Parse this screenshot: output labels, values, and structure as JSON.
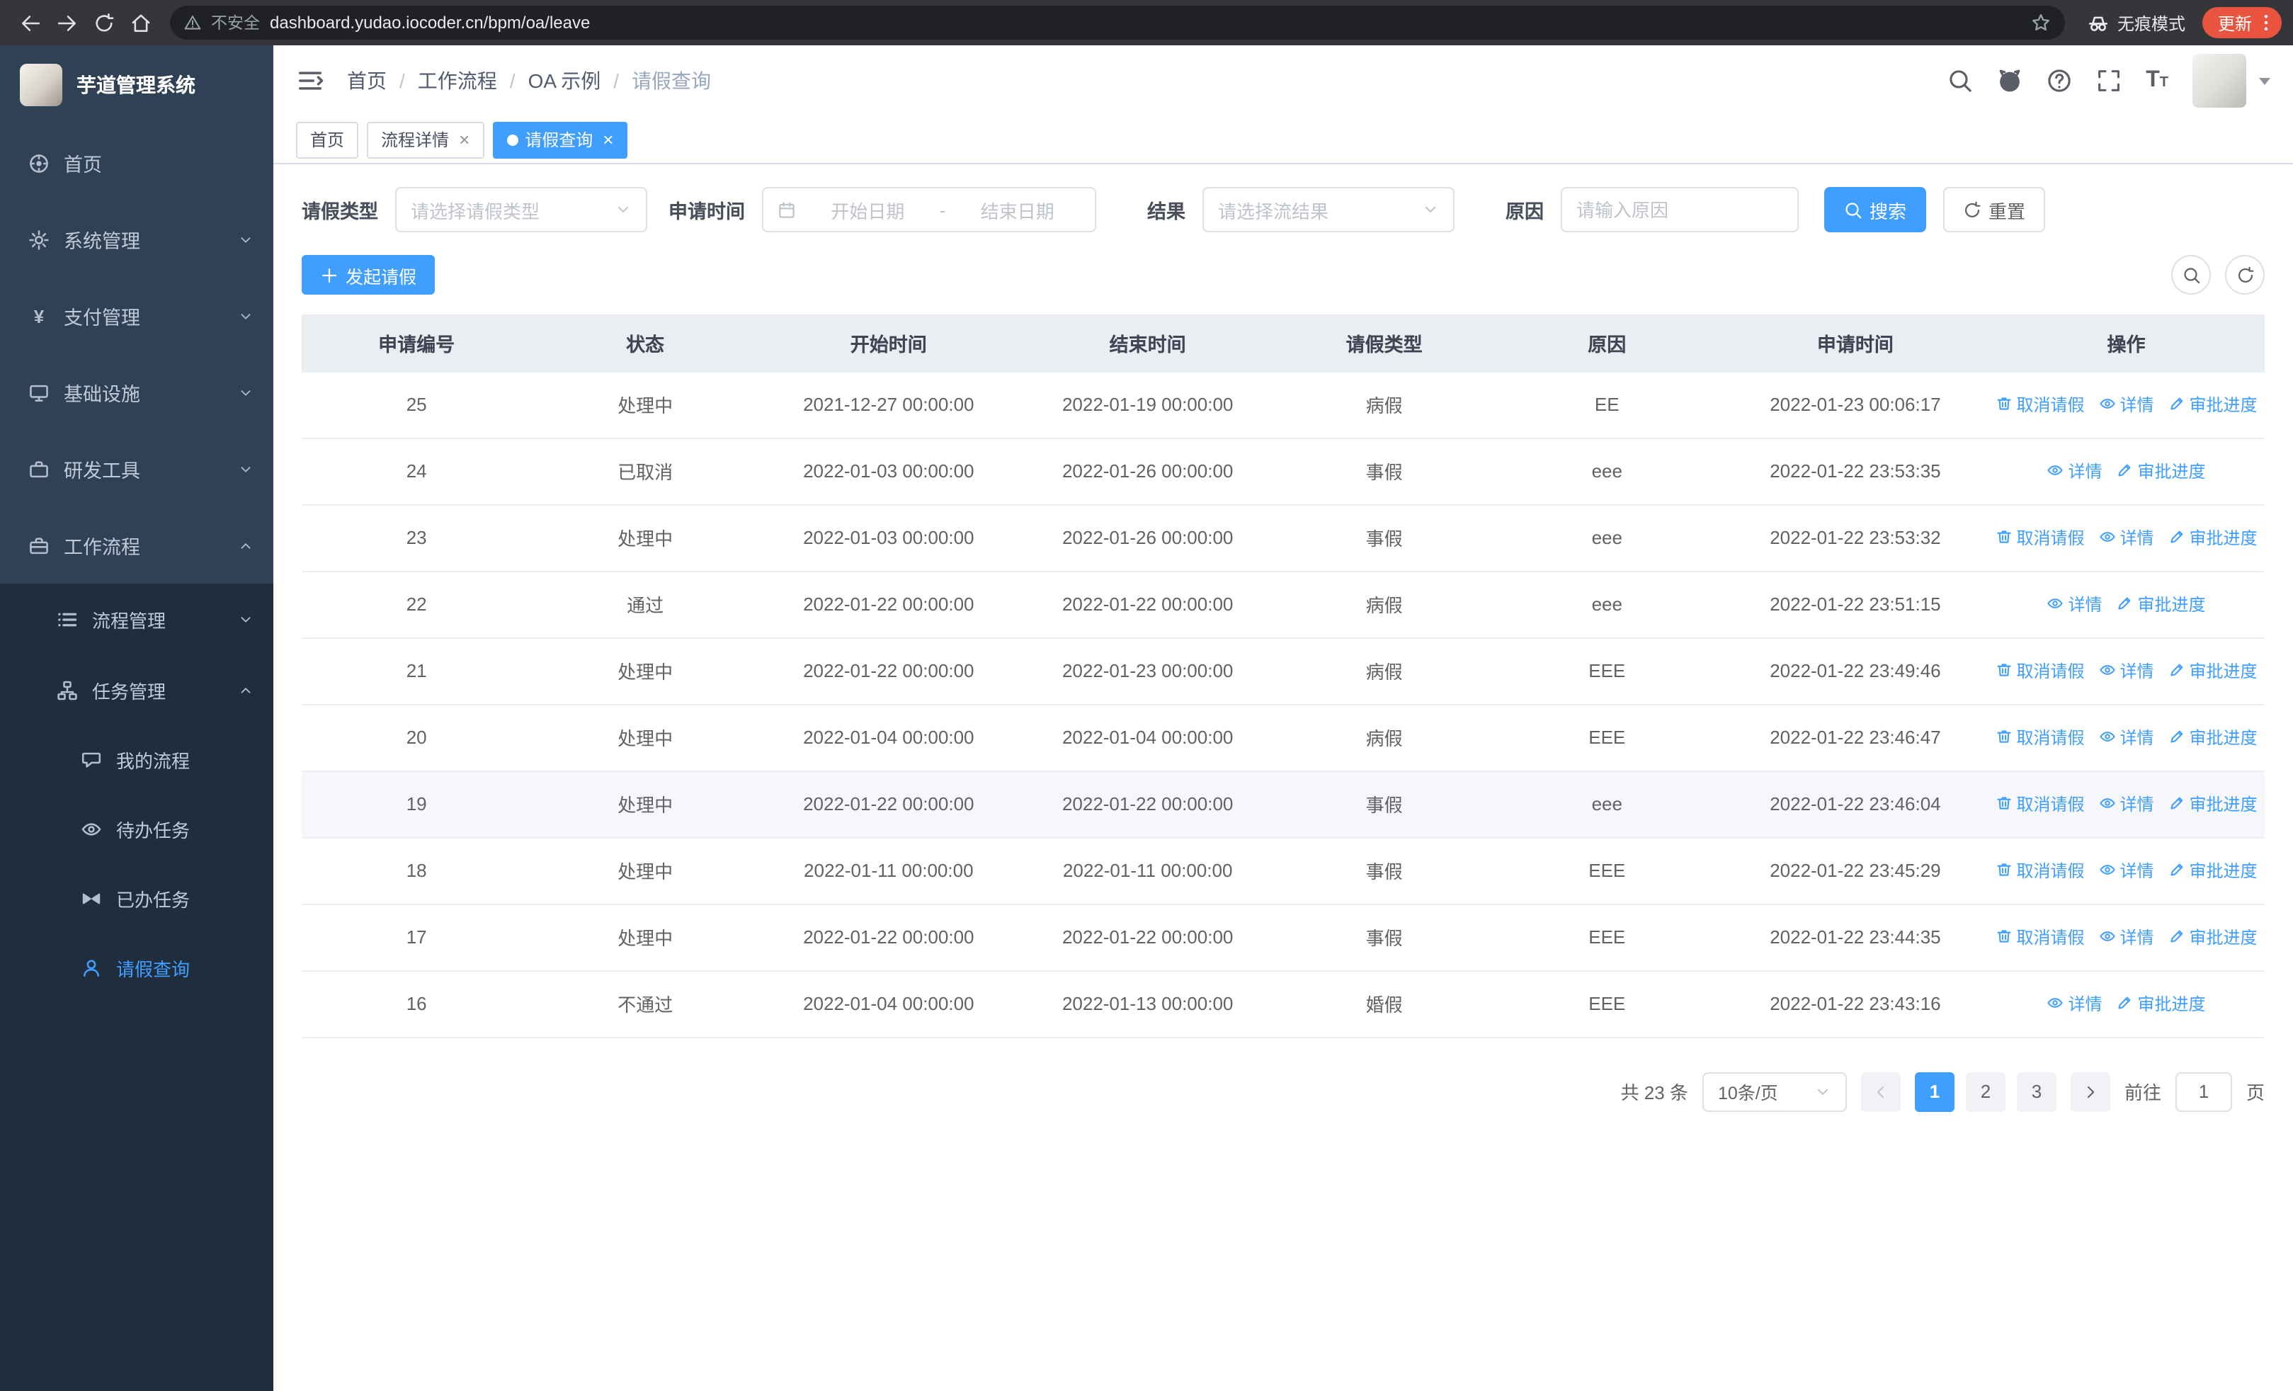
{
  "browser": {
    "security_label": "不安全",
    "url": "dashboard.yudao.iocoder.cn/bpm/oa/leave",
    "incognito_label": "无痕模式",
    "update_label": "更新"
  },
  "sidebar": {
    "logo_title": "芋道管理系统",
    "menu": [
      {
        "key": "home",
        "label": "首页",
        "icon": "home"
      },
      {
        "key": "system",
        "label": "系统管理",
        "icon": "gear",
        "state": "collapsed"
      },
      {
        "key": "payment",
        "label": "支付管理",
        "icon": "yen",
        "state": "collapsed"
      },
      {
        "key": "infra",
        "label": "基础设施",
        "icon": "monitor",
        "state": "collapsed"
      },
      {
        "key": "devtools",
        "label": "研发工具",
        "icon": "toolbox",
        "state": "collapsed"
      },
      {
        "key": "workflow",
        "label": "工作流程",
        "icon": "briefcase",
        "state": "expanded",
        "children": [
          {
            "key": "process-mgmt",
            "label": "流程管理",
            "icon": "listicon",
            "state": "collapsed"
          },
          {
            "key": "task-mgmt",
            "label": "任务管理",
            "icon": "flow",
            "state": "expanded",
            "children": [
              {
                "key": "my-process",
                "label": "我的流程",
                "icon": "chat"
              },
              {
                "key": "todo-task",
                "label": "待办任务",
                "icon": "eye"
              },
              {
                "key": "done-task",
                "label": "已办任务",
                "icon": "bowtie"
              },
              {
                "key": "leave-query",
                "label": "请假查询",
                "icon": "user",
                "active": true
              }
            ]
          }
        ]
      }
    ]
  },
  "header": {
    "breadcrumb": [
      "首页",
      "工作流程",
      "OA 示例",
      "请假查询"
    ]
  },
  "tabs": [
    {
      "key": "home",
      "label": "首页",
      "closable": false,
      "active": false
    },
    {
      "key": "process-detail",
      "label": "流程详情",
      "closable": true,
      "active": false
    },
    {
      "key": "leave-query",
      "label": "请假查询",
      "closable": true,
      "active": true
    }
  ],
  "filters": {
    "type_label": "请假类型",
    "type_placeholder": "请选择请假类型",
    "time_label": "申请时间",
    "start_placeholder": "开始日期",
    "range_separator": "-",
    "end_placeholder": "结束日期",
    "result_label": "结果",
    "result_placeholder": "请选择流结果",
    "reason_label": "原因",
    "reason_placeholder": "请输入原因",
    "search_label": "搜索",
    "reset_label": "重置"
  },
  "toolbar": {
    "create_label": "发起请假"
  },
  "table": {
    "headers": [
      "申请编号",
      "状态",
      "开始时间",
      "结束时间",
      "请假类型",
      "原因",
      "申请时间",
      "操作"
    ],
    "actions": {
      "cancel": "取消请假",
      "detail": "详情",
      "progress": "审批进度"
    },
    "rows": [
      {
        "id": "25",
        "status": "处理中",
        "start": "2021-12-27 00:00:00",
        "end": "2022-01-19 00:00:00",
        "type": "病假",
        "reason": "EE",
        "applied": "2022-01-23 00:06:17",
        "cancelable": true
      },
      {
        "id": "24",
        "status": "已取消",
        "start": "2022-01-03 00:00:00",
        "end": "2022-01-26 00:00:00",
        "type": "事假",
        "reason": "eee",
        "applied": "2022-01-22 23:53:35",
        "cancelable": false
      },
      {
        "id": "23",
        "status": "处理中",
        "start": "2022-01-03 00:00:00",
        "end": "2022-01-26 00:00:00",
        "type": "事假",
        "reason": "eee",
        "applied": "2022-01-22 23:53:32",
        "cancelable": true
      },
      {
        "id": "22",
        "status": "通过",
        "start": "2022-01-22 00:00:00",
        "end": "2022-01-22 00:00:00",
        "type": "病假",
        "reason": "eee",
        "applied": "2022-01-22 23:51:15",
        "cancelable": false
      },
      {
        "id": "21",
        "status": "处理中",
        "start": "2022-01-22 00:00:00",
        "end": "2022-01-23 00:00:00",
        "type": "病假",
        "reason": "EEE",
        "applied": "2022-01-22 23:49:46",
        "cancelable": true
      },
      {
        "id": "20",
        "status": "处理中",
        "start": "2022-01-04 00:00:00",
        "end": "2022-01-04 00:00:00",
        "type": "病假",
        "reason": "EEE",
        "applied": "2022-01-22 23:46:47",
        "cancelable": true
      },
      {
        "id": "19",
        "status": "处理中",
        "start": "2022-01-22 00:00:00",
        "end": "2022-01-22 00:00:00",
        "type": "事假",
        "reason": "eee",
        "applied": "2022-01-22 23:46:04",
        "cancelable": true,
        "highlighted": true
      },
      {
        "id": "18",
        "status": "处理中",
        "start": "2022-01-11 00:00:00",
        "end": "2022-01-11 00:00:00",
        "type": "事假",
        "reason": "EEE",
        "applied": "2022-01-22 23:45:29",
        "cancelable": true
      },
      {
        "id": "17",
        "status": "处理中",
        "start": "2022-01-22 00:00:00",
        "end": "2022-01-22 00:00:00",
        "type": "事假",
        "reason": "EEE",
        "applied": "2022-01-22 23:44:35",
        "cancelable": true
      },
      {
        "id": "16",
        "status": "不通过",
        "start": "2022-01-04 00:00:00",
        "end": "2022-01-13 00:00:00",
        "type": "婚假",
        "reason": "EEE",
        "applied": "2022-01-22 23:43:16",
        "cancelable": false
      }
    ]
  },
  "pagination": {
    "total": "共 23 条",
    "page_size": "10条/页",
    "pages": [
      "1",
      "2",
      "3"
    ],
    "active_page": "1",
    "goto_label": "前往",
    "goto_value": "1",
    "page_label": "页"
  },
  "colors": {
    "accent": "#409EFF",
    "sidebar_bg": "#304156",
    "submenu_bg": "#1f2d3d",
    "update_badge": "#e8543f"
  }
}
